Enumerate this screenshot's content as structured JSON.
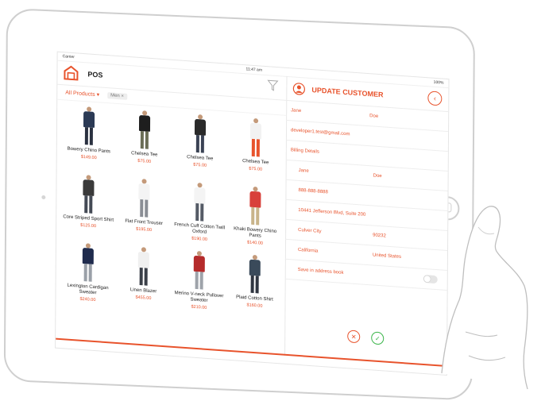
{
  "status_bar": {
    "carrier": "Carrier",
    "time": "11:47 am",
    "battery": "100%"
  },
  "header": {
    "title": "POS"
  },
  "filters": {
    "category": "All Products",
    "chip": "Men ×"
  },
  "products": [
    {
      "name": "Bowery Chino Pants",
      "price": "$149.00",
      "top": "#2b3a55",
      "bottom": "#2a3140"
    },
    {
      "name": "Chelsea Tee",
      "price": "$75.00",
      "top": "#1e1e1e",
      "bottom": "#6a6d55"
    },
    {
      "name": "Chelsea Tee",
      "price": "$75.00",
      "top": "#2a2a2a",
      "bottom": "#3a4254"
    },
    {
      "name": "Chelsea Tee",
      "price": "$75.00",
      "top": "#f2f2f2",
      "bottom": "#e8532c"
    },
    {
      "name": "Core Striped Sport Shirt",
      "price": "$125.00",
      "top": "#3a3a3a",
      "bottom": "#444a55"
    },
    {
      "name": "Flat Front  Trouser",
      "price": "$195.00",
      "top": "#f4f4f4",
      "bottom": "#8a8e95"
    },
    {
      "name": "French Cuff Cotton Twill Oxford",
      "price": "$190.00",
      "top": "#f4f4f4",
      "bottom": "#555b66"
    },
    {
      "name": "Khaki Bowery Chino Pants",
      "price": "$140.00",
      "top": "#d8403a",
      "bottom": "#c9b48a"
    },
    {
      "name": "Lexington Cardigan Sweater",
      "price": "$240.00",
      "top": "#1f2b4d",
      "bottom": "#9aa0a8"
    },
    {
      "name": "Linen Blazer",
      "price": "$455.00",
      "top": "#f0f0f0",
      "bottom": "#3a3f48"
    },
    {
      "name": "Merino V-neck Pullover Sweater",
      "price": "$210.00",
      "top": "#b52b2b",
      "bottom": "#9ea3aa"
    },
    {
      "name": "Plaid Cotton Shirt",
      "price": "$160.00",
      "top": "#3a4a5a",
      "bottom": "#2f3540"
    }
  ],
  "customer": {
    "title": "UPDATE CUSTOMER",
    "first_name": "Jane",
    "last_name": "Doe",
    "email": "developer1.test@gmail.com",
    "billing_label": "Billing Details",
    "billing_first": "Jane",
    "billing_last": "Doe",
    "phone": "888-888-8888",
    "street": "10441 Jefferson Blvd, Suite 200",
    "city": "Culver City",
    "zip": "90232",
    "state": "California",
    "country": "United States",
    "save_label": "Save in address book"
  },
  "colors": {
    "accent": "#e8532c",
    "confirm": "#3bb54a"
  }
}
